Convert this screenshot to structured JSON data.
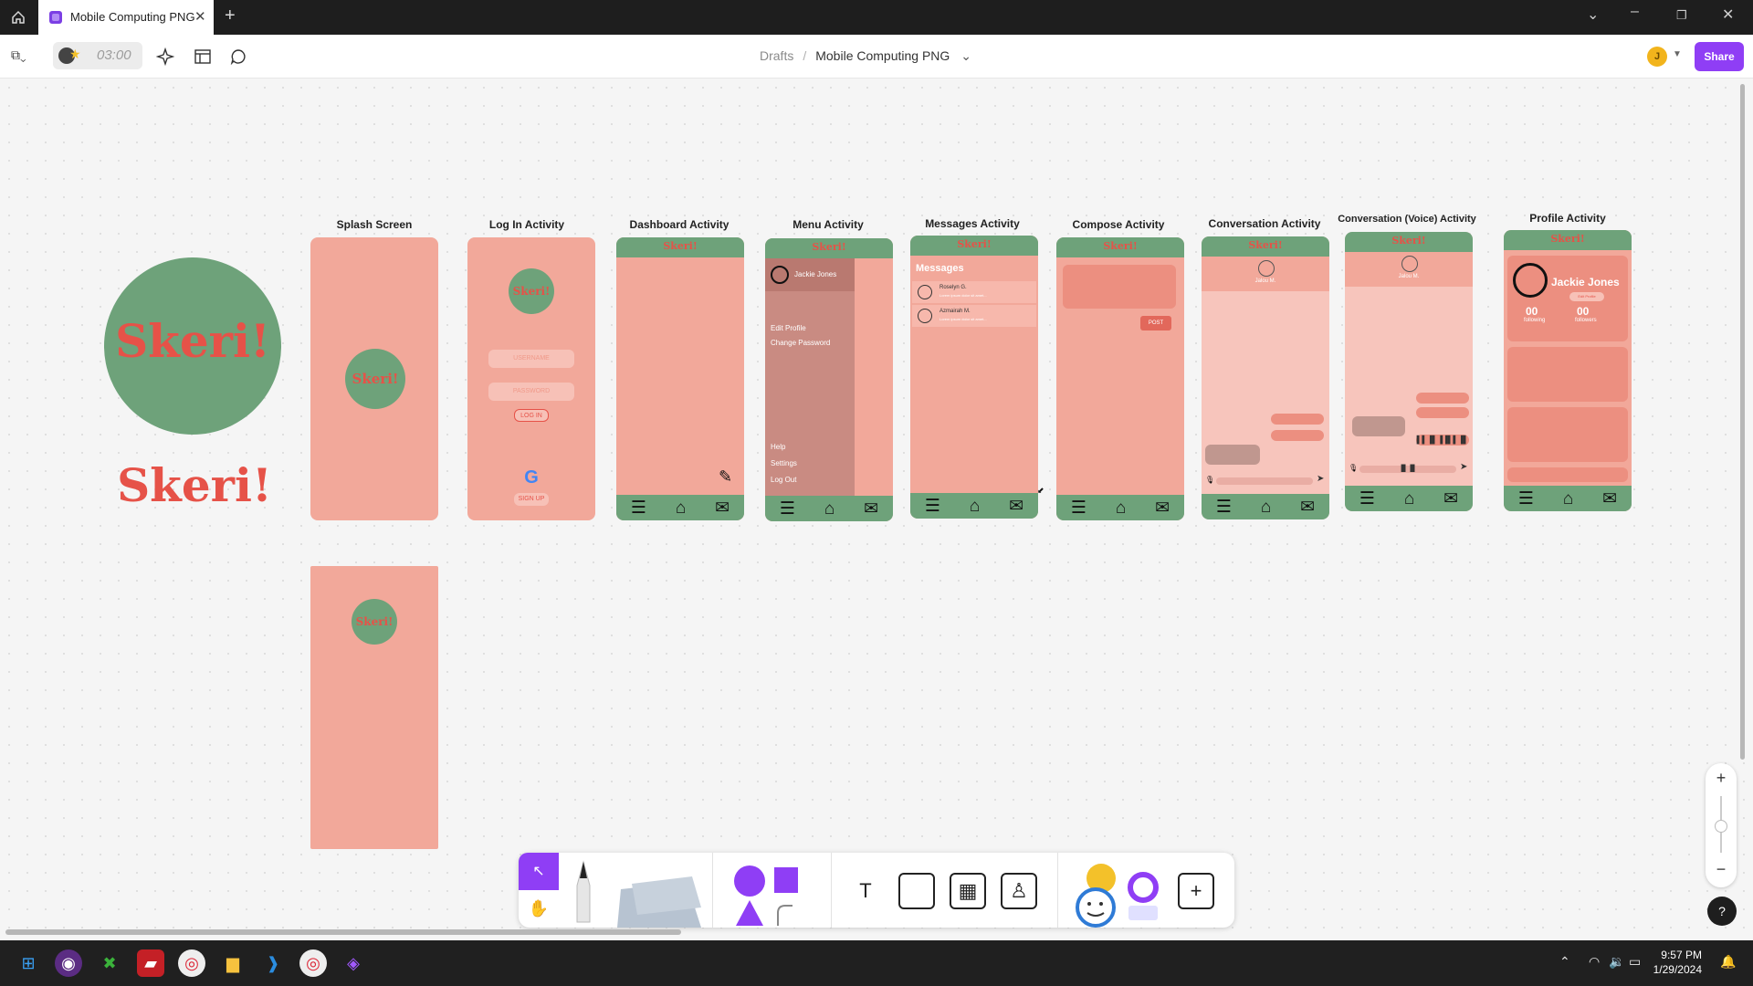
{
  "browser": {
    "tab_title": "Mobile Computing PNG",
    "new_tab": "+",
    "tab_close": "✕"
  },
  "toolbar": {
    "timer": "03:00",
    "breadcrumb_root": "Drafts",
    "breadcrumb_sep": "/",
    "file_name": "Mobile Computing PNG",
    "file_chevron": "⌄",
    "avatar_initial": "J",
    "share_label": "Share"
  },
  "logo_text": "Skeri!",
  "frames": {
    "splash": "Splash Screen",
    "login": "Log In Activity",
    "dashboard": "Dashboard Activity",
    "menu": "Menu Activity",
    "messages": "Messages Activity",
    "compose": "Compose Activity",
    "conversation": "Conversation Activity",
    "conversation_voice": "Conversation (Voice) Activity",
    "profile": "Profile Activity"
  },
  "login": {
    "username": "USERNAME",
    "password": "PASSWORD",
    "login_btn": "LOG IN",
    "signup_btn": "SIGN UP"
  },
  "menu": {
    "user": "Jackie Jones",
    "items": [
      "Edit Profile",
      "Change Password"
    ],
    "bottom_items": [
      "Help",
      "Settings",
      "Log Out"
    ]
  },
  "messages": {
    "title": "Messages",
    "threads": [
      {
        "name": "Roselyn G.",
        "preview": "Lorem ipsum dolor sit amet..."
      },
      {
        "name": "Azmairah M.",
        "preview": "Lorem ipsum dolor sit amet..."
      }
    ]
  },
  "compose": {
    "post_btn": "POST"
  },
  "conversation": {
    "contact": "Jalou M."
  },
  "conversation_voice": {
    "contact": "Jalou M."
  },
  "profile": {
    "name": "Jackie Jones",
    "edit": "Edit Profile",
    "following_count": "00",
    "following_label": "following",
    "followers_count": "00",
    "followers_label": "followers"
  },
  "taskbar": {
    "time": "9:57 PM",
    "date": "1/29/2024"
  },
  "colors": {
    "phone_bg": "#f2a89a",
    "green": "#6ea27a",
    "logo_red": "#e65248",
    "figma_purple": "#8f3ef5"
  }
}
